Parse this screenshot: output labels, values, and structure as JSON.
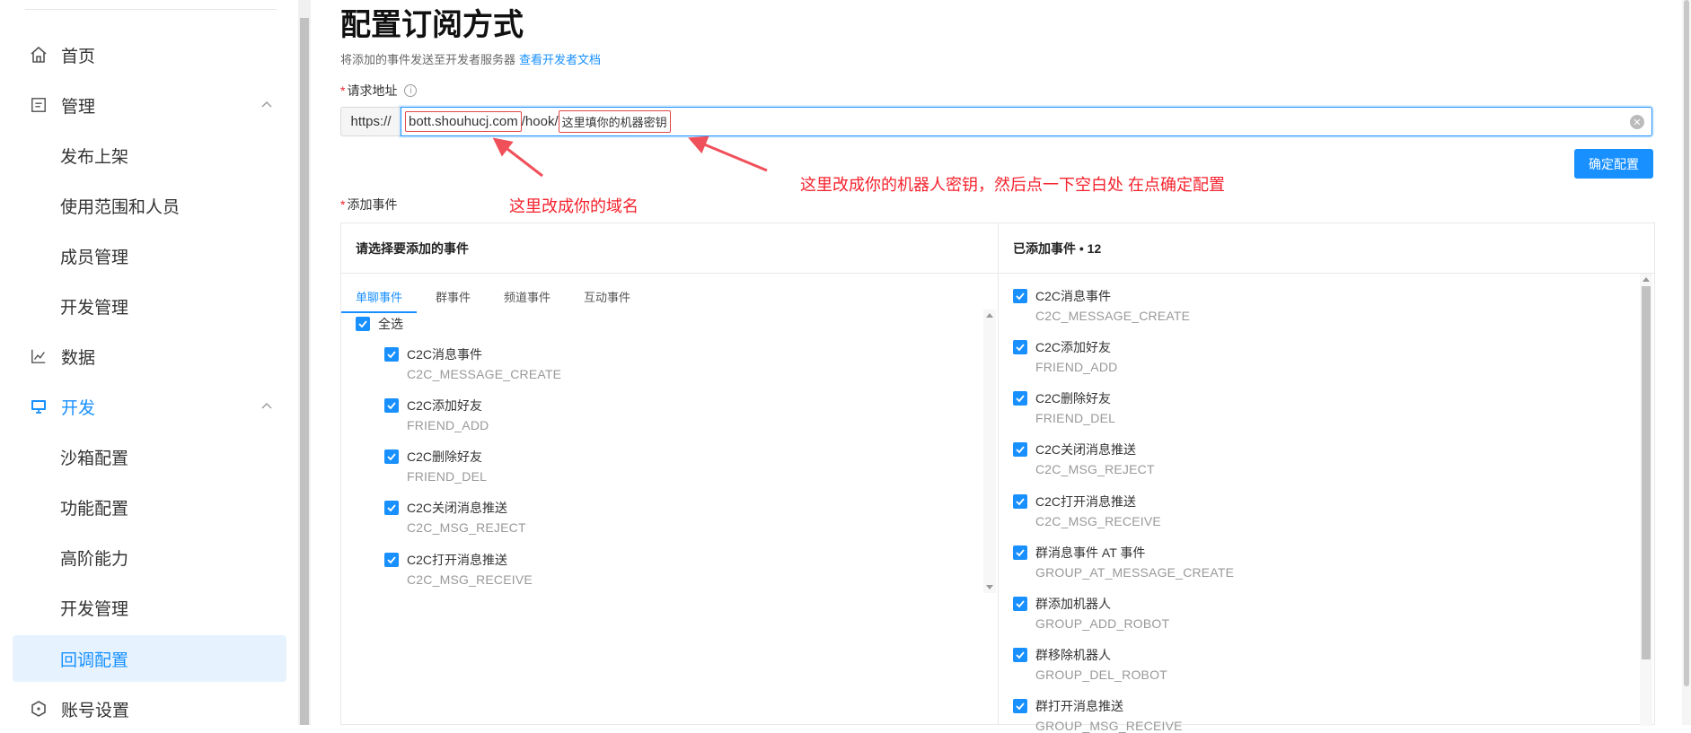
{
  "sidebar": {
    "items": [
      {
        "label": "首页",
        "icon": "home-icon"
      },
      {
        "label": "管理",
        "icon": "list-icon"
      },
      {
        "label": "发布上架"
      },
      {
        "label": "使用范围和人员"
      },
      {
        "label": "成员管理"
      },
      {
        "label": "开发管理"
      },
      {
        "label": "数据",
        "icon": "chart-icon"
      },
      {
        "label": "开发",
        "icon": "monitor-icon"
      },
      {
        "label": "沙箱配置"
      },
      {
        "label": "功能配置"
      },
      {
        "label": "高阶能力"
      },
      {
        "label": "开发管理"
      },
      {
        "label": "回调配置"
      },
      {
        "label": "账号设置",
        "icon": "hexagon-icon"
      }
    ]
  },
  "main": {
    "title": "配置订阅方式",
    "subtitle": "将添加的事件发送至开发者服务器",
    "doc_link": "查看开发者文档",
    "url_label": "请求地址",
    "url_prefix": "https://",
    "url_domain": "bott.shouhucj.com",
    "url_path": "/hook/",
    "url_secret": "这里填你的机器密钥",
    "confirm_button": "确定配置",
    "events_label": "添加事件",
    "annotation_secret": "这里改成你的机器人密钥，然后点一下空白处  在点确定配置",
    "annotation_domain": "这里改成你的域名"
  },
  "left_panel": {
    "header": "请选择要添加的事件",
    "tabs": [
      "单聊事件",
      "群事件",
      "频道事件",
      "互动事件"
    ],
    "select_all": "全选",
    "events": [
      {
        "title": "C2C消息事件",
        "code": "C2C_MESSAGE_CREATE"
      },
      {
        "title": "C2C添加好友",
        "code": "FRIEND_ADD"
      },
      {
        "title": "C2C删除好友",
        "code": "FRIEND_DEL"
      },
      {
        "title": "C2C关闭消息推送",
        "code": "C2C_MSG_REJECT"
      },
      {
        "title": "C2C打开消息推送",
        "code": "C2C_MSG_RECEIVE"
      }
    ]
  },
  "right_panel": {
    "header": "已添加事件 • 12",
    "events": [
      {
        "title": "C2C消息事件",
        "code": "C2C_MESSAGE_CREATE"
      },
      {
        "title": "C2C添加好友",
        "code": "FRIEND_ADD"
      },
      {
        "title": "C2C删除好友",
        "code": "FRIEND_DEL"
      },
      {
        "title": "C2C关闭消息推送",
        "code": "C2C_MSG_REJECT"
      },
      {
        "title": "C2C打开消息推送",
        "code": "C2C_MSG_RECEIVE"
      },
      {
        "title": "群消息事件 AT 事件",
        "code": "GROUP_AT_MESSAGE_CREATE"
      },
      {
        "title": "群添加机器人",
        "code": "GROUP_ADD_ROBOT"
      },
      {
        "title": "群移除机器人",
        "code": "GROUP_DEL_ROBOT"
      },
      {
        "title": "群打开消息推送",
        "code": "GROUP_MSG_RECEIVE"
      }
    ]
  },
  "colors": {
    "accent": "#1890ff",
    "annotation": "#f5222d",
    "selected_bg": "#e6f3ff"
  }
}
